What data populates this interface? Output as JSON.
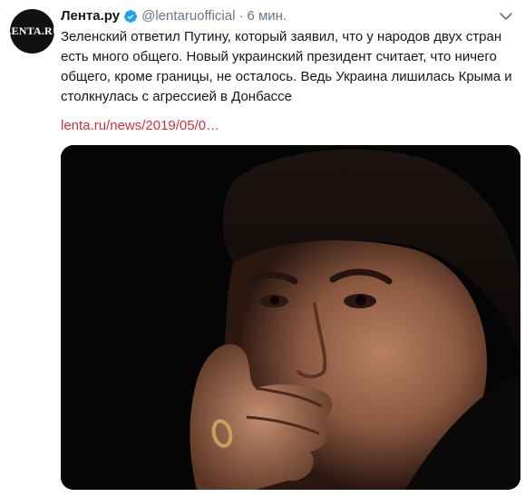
{
  "tweet": {
    "avatar": {
      "label": "LENTA.RU",
      "icon": "lenta-logo-avatar"
    },
    "author_name": "Лента.ру",
    "verified_icon": "verified-badge-icon",
    "handle": "@lentaruofficial",
    "separator": "·",
    "time": "6 мин.",
    "menu_icon": "chevron-down-icon",
    "text": "Зеленский ответил Путину, который заявил, что у народов двух стран есть много общего. Новый украинский президент считает, что ничего общего, кроме границы, не осталось. Ведь Украина лишилась Крыма и столкнулась с агрессией в Донбассе",
    "link": "lenta.ru/news/2019/05/0…",
    "media": {
      "type": "photo"
    }
  },
  "colors": {
    "link": "#d2303a",
    "verified": "#1da1f2",
    "secondary_text": "#657786"
  }
}
